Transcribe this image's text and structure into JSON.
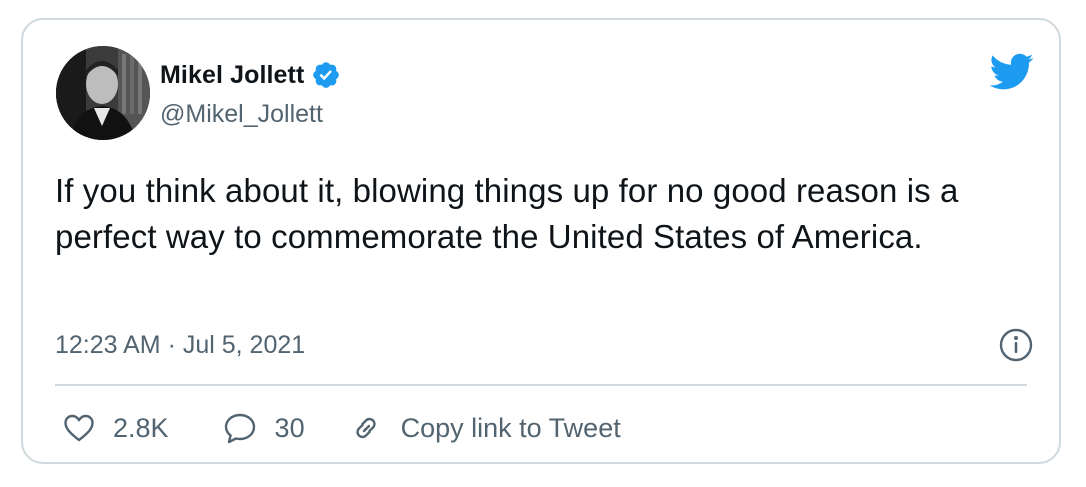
{
  "author": {
    "display_name": "Mikel Jollett",
    "handle": "@Mikel_Jollett",
    "verified": true
  },
  "tweet": {
    "text": "If you think about it, blowing things up for no good reason is a perfect way to commemorate the United States of America.",
    "timestamp": "12:23 AM · Jul 5, 2021"
  },
  "actions": {
    "likes": "2.8K",
    "replies": "30",
    "copy_link_label": "Copy link to Tweet"
  },
  "icons": {
    "brand": "twitter-bird-icon",
    "verified": "verified-badge-icon",
    "info": "info-icon",
    "like": "heart-icon",
    "reply": "speech-bubble-icon",
    "copy_link": "link-icon"
  },
  "colors": {
    "brand_blue": "#1d9bf0",
    "text_primary": "#0f1419",
    "text_secondary": "#536471",
    "border": "#cfd9de"
  }
}
